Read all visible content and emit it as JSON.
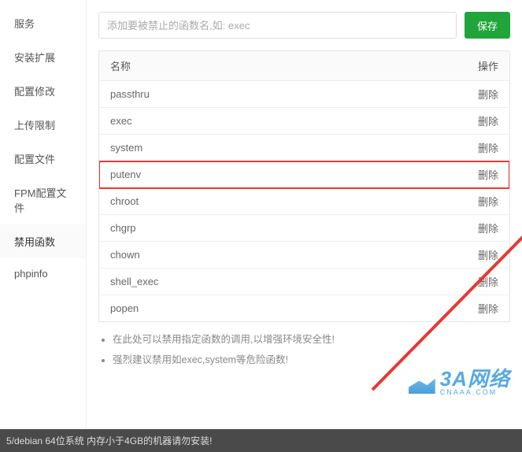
{
  "sidebar": {
    "items": [
      {
        "label": "服务"
      },
      {
        "label": "安装扩展"
      },
      {
        "label": "配置修改"
      },
      {
        "label": "上传限制"
      },
      {
        "label": "配置文件"
      },
      {
        "label": "FPM配置文件"
      },
      {
        "label": "禁用函数",
        "active": true
      },
      {
        "label": "phpinfo"
      }
    ]
  },
  "toolbar": {
    "input_placeholder": "添加要被禁止的函数名,如: exec",
    "save_label": "保存"
  },
  "table": {
    "header_name": "名称",
    "header_op": "操作",
    "delete_label": "删除",
    "rows": [
      {
        "name": "passthru"
      },
      {
        "name": "exec"
      },
      {
        "name": "system"
      },
      {
        "name": "putenv",
        "highlight": true
      },
      {
        "name": "chroot"
      },
      {
        "name": "chgrp"
      },
      {
        "name": "chown"
      },
      {
        "name": "shell_exec"
      },
      {
        "name": "popen"
      }
    ]
  },
  "hints": [
    "在此处可以禁用指定函数的调用,以增强环境安全性!",
    "强烈建议禁用如exec,system等危险函数!"
  ],
  "watermark": {
    "brand": "3A网络",
    "sub": "CNAAA.COM"
  },
  "footer": "5/debian 64位系统 内存小于4GB的机器请勿安装!"
}
